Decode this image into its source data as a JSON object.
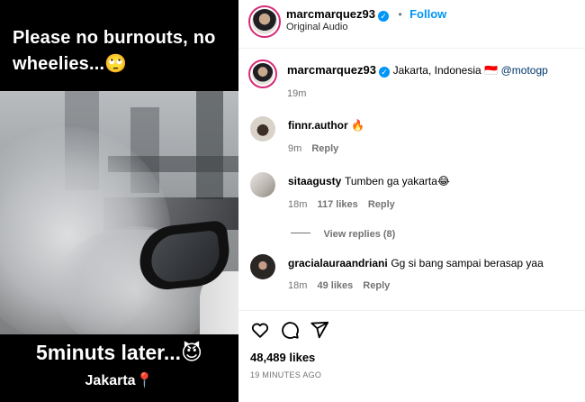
{
  "media": {
    "caption_top": "Please no burnouts, no wheelies...🙄",
    "caption_bottom": "5minuts later...😈",
    "caption_location": "Jakarta📍"
  },
  "header": {
    "username": "marcmarquez93",
    "dot": "•",
    "follow_label": "Follow",
    "subtitle": "Original Audio"
  },
  "post": {
    "username": "marcmarquez93",
    "caption": "Jakarta, Indonesia 🇮🇩",
    "mention": "@motogp",
    "time": "19m"
  },
  "comments": [
    {
      "username": "finnr.author",
      "text": "🔥",
      "time": "9m",
      "likes": "",
      "reply": "Reply"
    },
    {
      "username": "sitaagusty",
      "text": "Tumben ga yakarta😂",
      "time": "18m",
      "likes": "117 likes",
      "reply": "Reply",
      "view_replies": "View replies (8)"
    },
    {
      "username": "gracialauraandriani",
      "text": "Gg si bang sampai berasap yaa",
      "time": "18m",
      "likes": "49 likes",
      "reply": "Reply"
    }
  ],
  "actions": {
    "likes": "48,489 likes",
    "timestamp": "19 MINUTES AGO"
  },
  "colors": {
    "accent": "#0095f6",
    "muted": "#737373",
    "link": "#00376b"
  }
}
